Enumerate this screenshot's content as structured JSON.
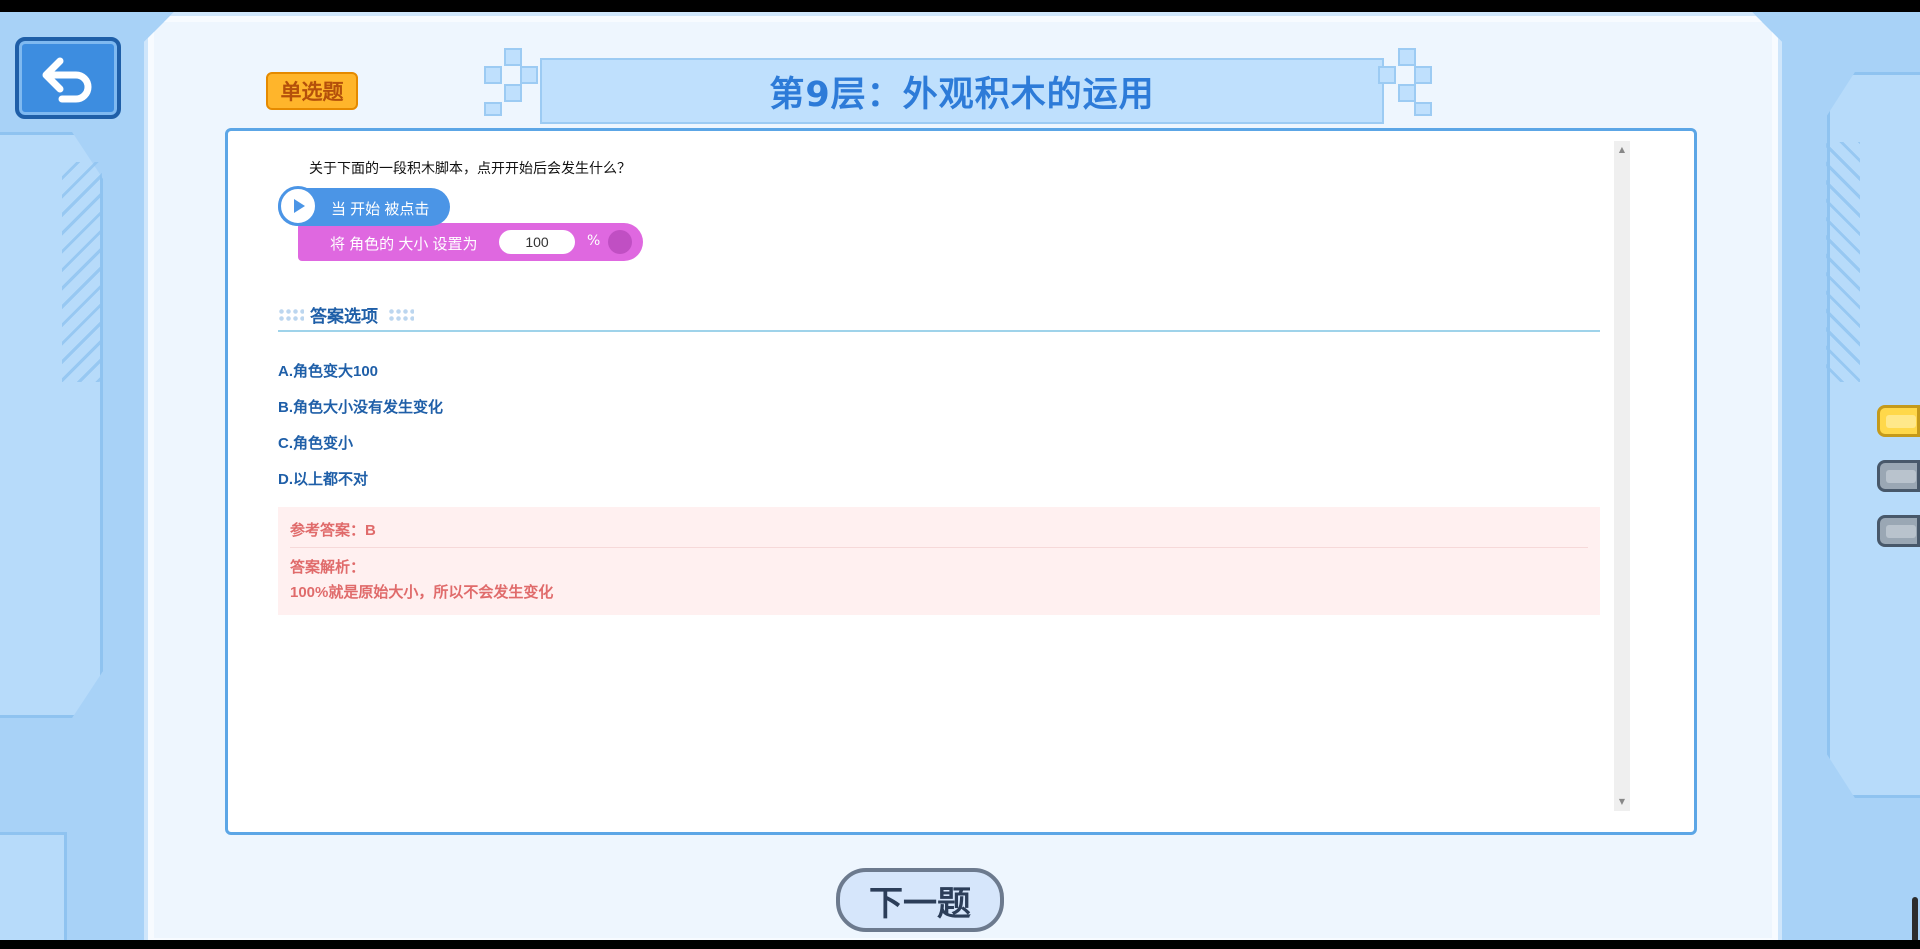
{
  "app": {
    "type_badge": "单选题",
    "title": "第9层：外观积木的运用"
  },
  "question": {
    "text": "关于下面的一段积木脚本，点开开始后会发生什么？",
    "blocks": {
      "hat_label": "当 开始 被点击",
      "size_label": "将 角色的 大小 设置为",
      "size_value": "100",
      "size_unit": "%"
    }
  },
  "answers": {
    "section_title": "答案选项",
    "options": [
      "A.角色变大100",
      "B.角色大小没有发生变化",
      "C.角色变小",
      "D.以上都不对"
    ],
    "reference": "参考答案：B",
    "explanation_label": "答案解析：",
    "explanation_text": "100%就是原始大小，所以不会发生变化"
  },
  "nav": {
    "next_label": "下一题",
    "side_tabs": [
      {
        "state": "active",
        "color": "#ffd84a"
      },
      {
        "state": "inactive",
        "color": "#9aa7b4"
      },
      {
        "state": "inactive",
        "color": "#9aa7b4"
      }
    ]
  },
  "icons": {
    "back": "back-arrow-icon",
    "play": "play-icon"
  },
  "colors": {
    "accent": "#2d7bd8",
    "badge": "#ffb52b",
    "motion_block": "#4b95e6",
    "looks_block": "#df68e0",
    "answer_text": "#e06b6b"
  }
}
